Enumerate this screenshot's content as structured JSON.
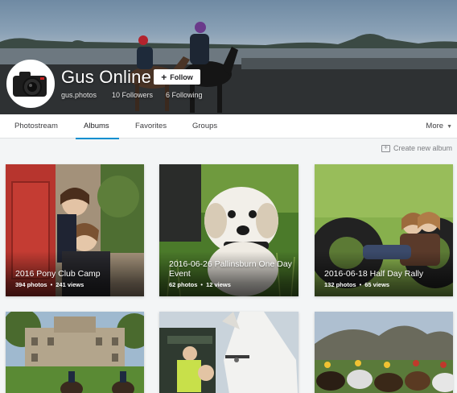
{
  "profile": {
    "name": "Gus Online",
    "username": "gus.photos",
    "followers": "10 Followers",
    "following": "6 Following",
    "follow_label": "Follow"
  },
  "tabs": [
    {
      "label": "Photostream",
      "active": false
    },
    {
      "label": "Albums",
      "active": true
    },
    {
      "label": "Favorites",
      "active": false
    },
    {
      "label": "Groups",
      "active": false
    }
  ],
  "more_label": "More",
  "create_album_label": "Create new album",
  "albums": [
    {
      "title": "2016 Pony Club Camp",
      "photos": "394 photos",
      "views": "241 views"
    },
    {
      "title": "2016-06-26 Pallinsburn One Day Event",
      "photos": "62 photos",
      "views": "12 views"
    },
    {
      "title": "2016-06-18 Half Day Rally",
      "photos": "132 photos",
      "views": "65 views"
    },
    {
      "title": "",
      "photos": "",
      "views": ""
    },
    {
      "title": "",
      "photos": "",
      "views": ""
    },
    {
      "title": "",
      "photos": "",
      "views": ""
    }
  ],
  "colors": {
    "accent": "#008ecf",
    "background": "#f3f5f6"
  },
  "icons": {
    "avatar": "camera-avatar",
    "follow": "plus-icon",
    "more": "chevron-down-icon",
    "create": "add-album-icon"
  }
}
